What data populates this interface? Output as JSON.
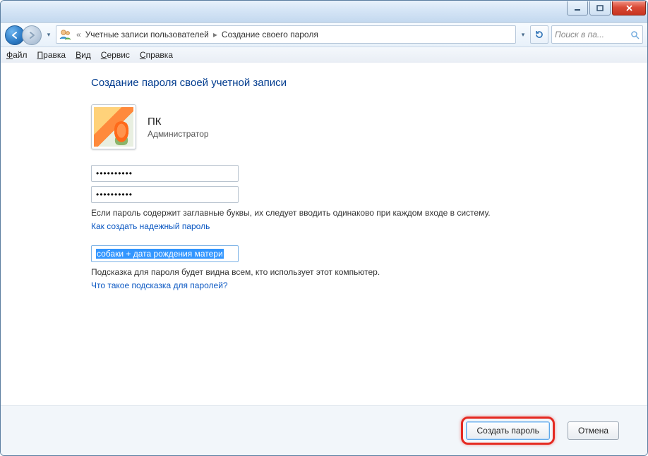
{
  "breadcrumb": {
    "item1": "Учетные записи пользователей",
    "item2": "Создание своего пароля"
  },
  "search": {
    "placeholder": "Поиск в па..."
  },
  "menu": {
    "file": "Файл",
    "edit": "Правка",
    "view": "Вид",
    "tools": "Сервис",
    "help": "Справка"
  },
  "page": {
    "title": "Создание пароля своей учетной записи",
    "user_name": "ПК",
    "user_role": "Администратор",
    "password_mask": "••••••••••",
    "confirm_mask": "••••••••••",
    "caps_notice": "Если пароль содержит заглавные буквы, их следует вводить одинаково при каждом входе в систему.",
    "strong_pw_link": "Как создать надежный пароль",
    "hint_value": "собаки + дата рождения матери",
    "hint_notice": "Подсказка для пароля будет видна всем, кто использует этот компьютер.",
    "hint_link": "Что такое подсказка для паролей?"
  },
  "buttons": {
    "create": "Создать пароль",
    "cancel": "Отмена"
  }
}
